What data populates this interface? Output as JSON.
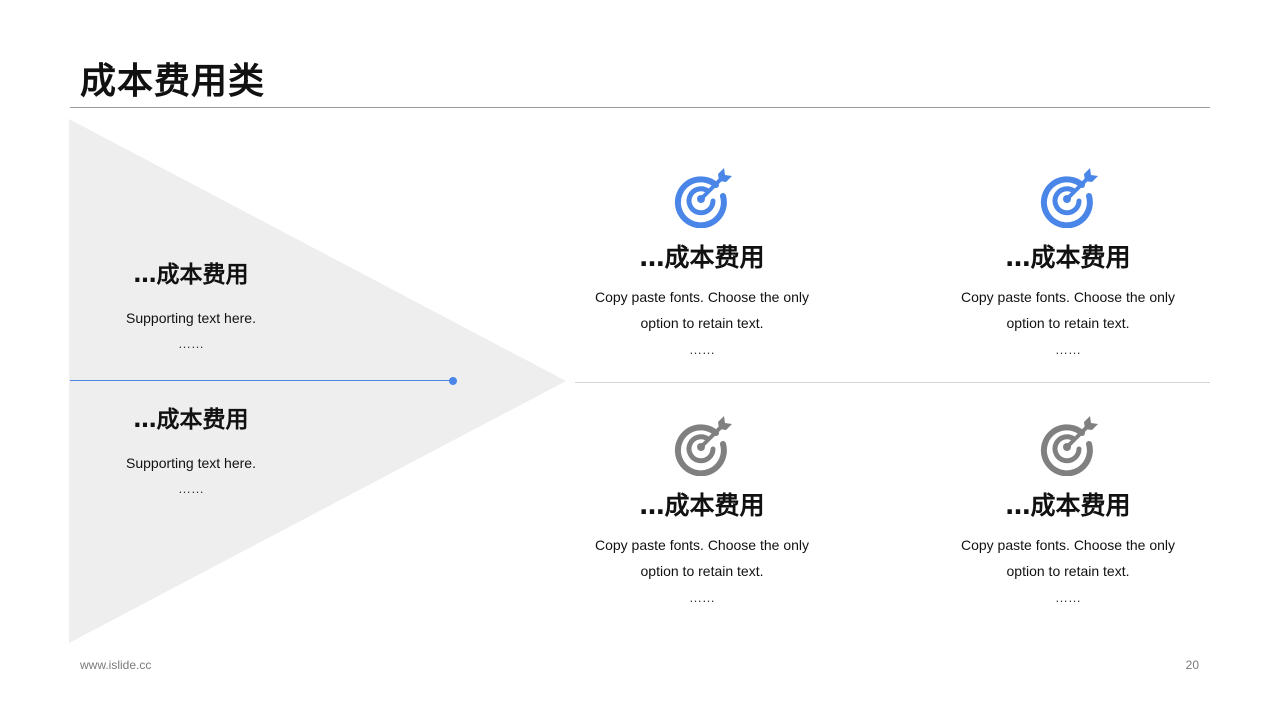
{
  "title": "成本费用类",
  "colors": {
    "accent": "#4a86e8",
    "icon_active": "#4a86e8",
    "icon_inactive": "#808080",
    "triangle_fill": "#eeeeee"
  },
  "left": [
    {
      "heading": "…成本费用",
      "text": "Supporting  text here.",
      "dots": "……"
    },
    {
      "heading": "…成本费用",
      "text": "Supporting  text here.",
      "dots": "……"
    }
  ],
  "cards": [
    {
      "icon": "target-arrow-icon",
      "heading": "…成本费用",
      "text": "Copy paste fonts. Choose the only option to retain text.",
      "dots": "……"
    },
    {
      "icon": "target-arrow-icon",
      "heading": "…成本费用",
      "text": "Copy paste fonts. Choose the only option to retain text.",
      "dots": "……"
    },
    {
      "icon": "target-arrow-icon",
      "heading": "…成本费用",
      "text": "Copy paste fonts. Choose the only option to retain text.",
      "dots": "……"
    },
    {
      "icon": "target-arrow-icon",
      "heading": "…成本费用",
      "text": "Copy paste fonts. Choose the only option to retain text.",
      "dots": "……"
    }
  ],
  "footer": {
    "website": "www.islide.cc",
    "page_number": "20"
  }
}
